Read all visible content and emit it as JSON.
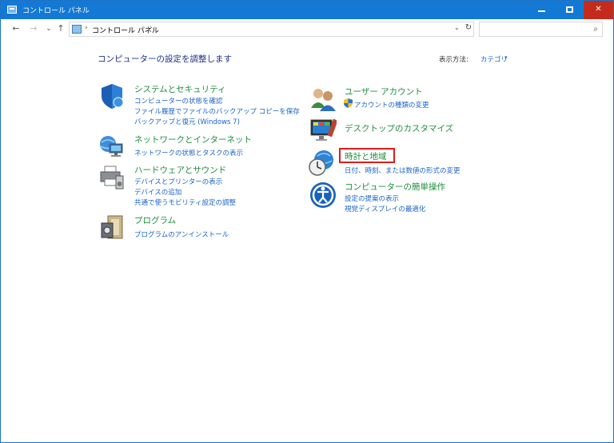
{
  "window": {
    "title": "コントロール パネル",
    "minimize_label": "–",
    "maximize_label": "□",
    "close_label": "✕"
  },
  "nav": {
    "back": "←",
    "forward": "→",
    "recent": "⌄",
    "up": "↑",
    "breadcrumb": "コントロール パネル",
    "separator": "›",
    "dropdown": "⌄",
    "refresh": "↻",
    "search_placeholder": "",
    "search_icon": "⌕"
  },
  "main": {
    "heading": "コンピューターの設定を調整します",
    "view_by_label": "表示方法:",
    "view_by_value": "カテゴリ",
    "view_by_caret": "▾"
  },
  "categories_left": [
    {
      "icon": "shield-icon",
      "title": "システムとセキュリティ",
      "links": [
        "コンピューターの状態を確認",
        "ファイル履歴でファイルのバックアップ コピーを保存",
        "バックアップと復元 (Windows 7)"
      ]
    },
    {
      "icon": "network-icon",
      "title": "ネットワークとインターネット",
      "links": [
        "ネットワークの状態とタスクの表示"
      ]
    },
    {
      "icon": "printer-icon",
      "title": "ハードウェアとサウンド",
      "links": [
        "デバイスとプリンターの表示",
        "デバイスの追加",
        "共通で使うモビリティ設定の調整"
      ]
    },
    {
      "icon": "programs-icon",
      "title": "プログラム",
      "links": [
        "プログラムのアンインストール"
      ]
    }
  ],
  "categories_right": [
    {
      "icon": "users-icon",
      "title": "ユーザー アカウント",
      "links": [
        "アカウントの種類の変更"
      ]
    },
    {
      "icon": "desktop-icon",
      "title": "デスクトップのカスタマイズ",
      "links": []
    },
    {
      "icon": "clock-globe-icon",
      "title": "時計と地域",
      "links": [
        "日付、時刻、または数値の形式の変更"
      ]
    },
    {
      "icon": "accessibility-icon",
      "title": "コンピューターの簡単操作",
      "links": [
        "設定の提案の表示",
        "視覚ディスプレイの最適化"
      ]
    }
  ],
  "colors": {
    "titlebar": "#1479d4",
    "heading": "#1e3287",
    "category_title": "#1f8e3e",
    "link": "#1a64c8",
    "highlight": "#e01a1a"
  }
}
